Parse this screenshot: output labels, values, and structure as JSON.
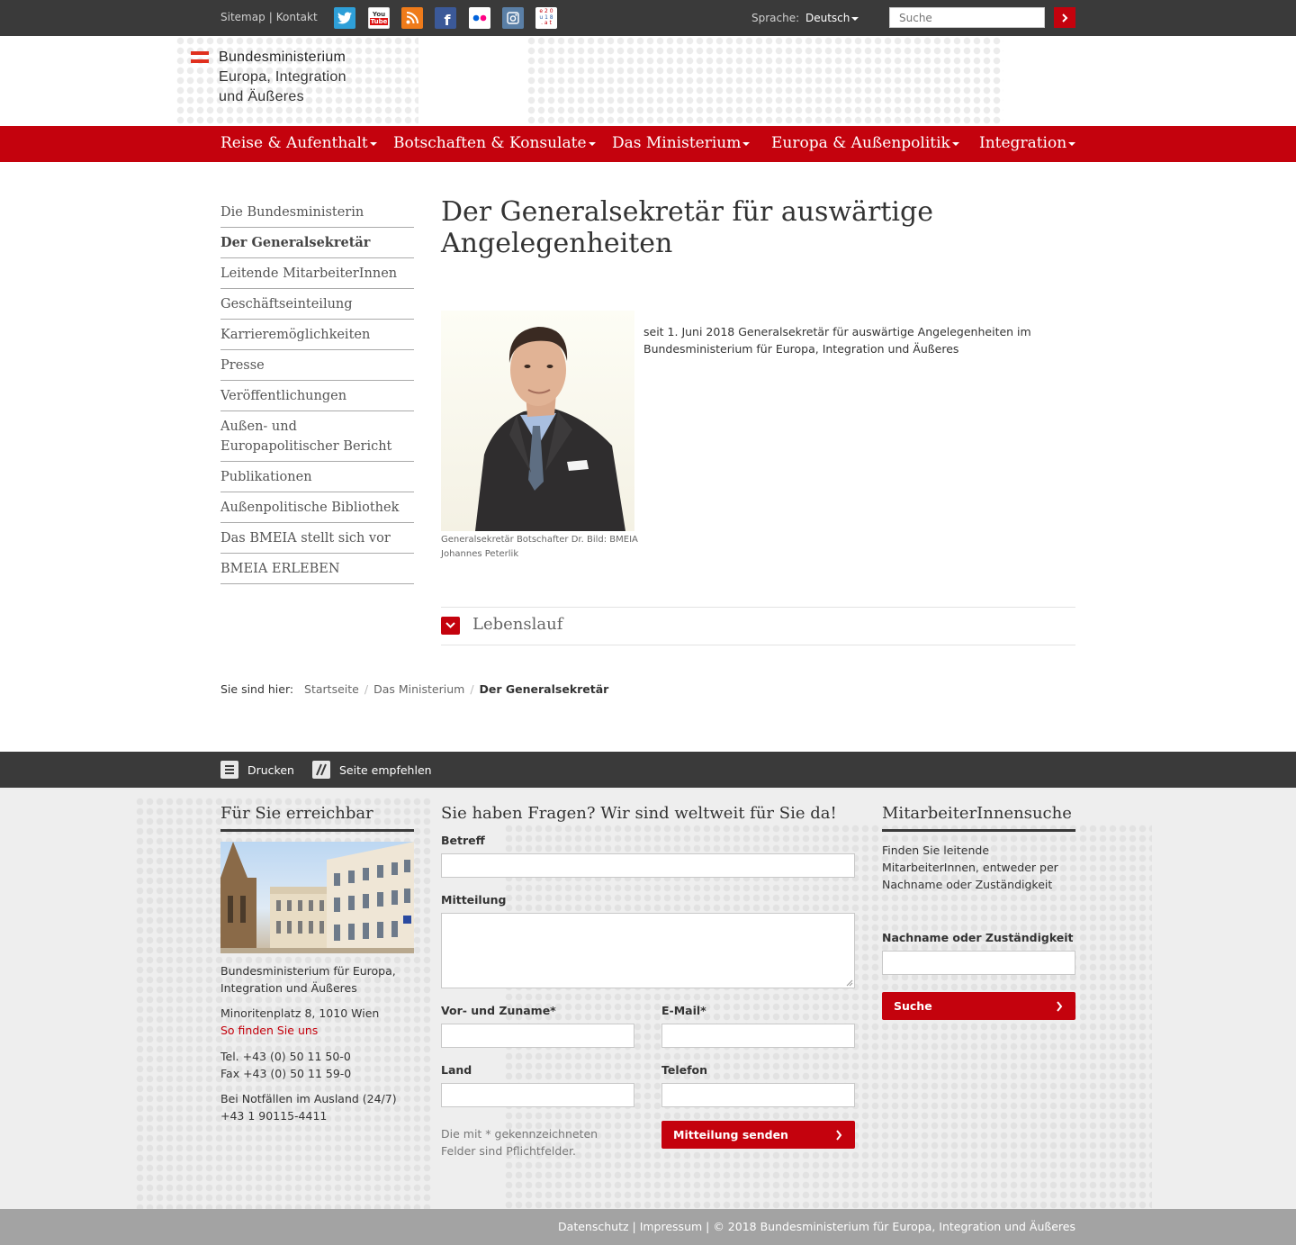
{
  "topbar": {
    "sitemap": "Sitemap",
    "kontakt": "Kontakt",
    "language_label": "Sprache:",
    "language_value": "Deutsch",
    "search_placeholder": "Suche",
    "social_icons": [
      "twitter-icon",
      "youtube-icon",
      "rss-icon",
      "facebook-icon",
      "flickr-icon",
      "instagram-icon",
      "eu2018-icon"
    ]
  },
  "logo": {
    "line1": "Bundesministerium",
    "line2": "Europa, Integration",
    "line3": "und Äußeres"
  },
  "mainnav": [
    "Reise & Aufenthalt",
    "Botschaften & Konsulate",
    "Das Ministerium",
    "Europa & Außenpolitik",
    "Integration"
  ],
  "sidenav": [
    "Die Bundesministerin",
    "Der Generalsekretär",
    "Leitende MitarbeiterInnen",
    "Geschäftseinteilung",
    "Karrieremöglichkeiten",
    "Presse",
    "Veröffentlichungen",
    "Außen- und Europapolitischer Bericht",
    "Publikationen",
    "Außenpolitische Bibliothek",
    "Das BMEIA stellt sich vor",
    "BMEIA ERLEBEN"
  ],
  "content": {
    "title": "Der Generalsekretär für auswärtige Angelegenheiten",
    "caption": "Generalsekretär Botschafter Dr. Bild: BMEIA Johannes Peterlik",
    "lead": "seit 1. Juni 2018 Generalsekretär für auswärtige Angelegenheiten im Bundesministerium für Europa, Integration und Äußeres",
    "accordion": "Lebenslauf"
  },
  "breadcrumb": {
    "label": "Sie sind hier:",
    "items": [
      "Startseite",
      "Das Ministerium"
    ],
    "current": "Der Generalsekretär"
  },
  "toolbar": {
    "print": "Drucken",
    "recommend": "Seite empfehlen"
  },
  "footer": {
    "col1": {
      "heading": "Für Sie erreichbar",
      "org": "Bundesministerium für Europa, Integration und Äußeres",
      "address": "Minoritenplatz 8, 1010 Wien",
      "directions": "So finden Sie uns",
      "tel": "Tel. +43 (0) 50 11 50-0",
      "fax": "Fax +43 (0) 50 11 59-0",
      "emergency_label": "Bei Notfällen im Ausland (24/7)",
      "emergency_number": "+43 1 90115-4411"
    },
    "col2": {
      "heading": "Sie haben Fragen? Wir sind weltweit für Sie da!",
      "subject_label": "Betreff",
      "message_label": "Mitteilung",
      "name_label": "Vor- und Zuname*",
      "email_label": "E-Mail*",
      "country_label": "Land",
      "phone_label": "Telefon",
      "required_note": "Die mit * gekennzeichneten Felder sind Pflichtfelder.",
      "submit": "Mitteilung senden"
    },
    "col3": {
      "heading": "MitarbeiterInnensuche",
      "intro": "Finden Sie leitende MitarbeiterInnen, entweder per Nachname oder Zuständigkeit",
      "field_label": "Nachname oder Zuständigkeit",
      "button": "Suche"
    }
  },
  "bottombar": "Datenschutz | Impressum | © 2018 Bundesministerium für Europa, Integration und Äußeres",
  "colors": {
    "brand_red": "#c4020d",
    "dark_bar": "#3a3a3a",
    "footer_bg": "#eeeeee",
    "bottom_bar": "#a3a3a3"
  }
}
